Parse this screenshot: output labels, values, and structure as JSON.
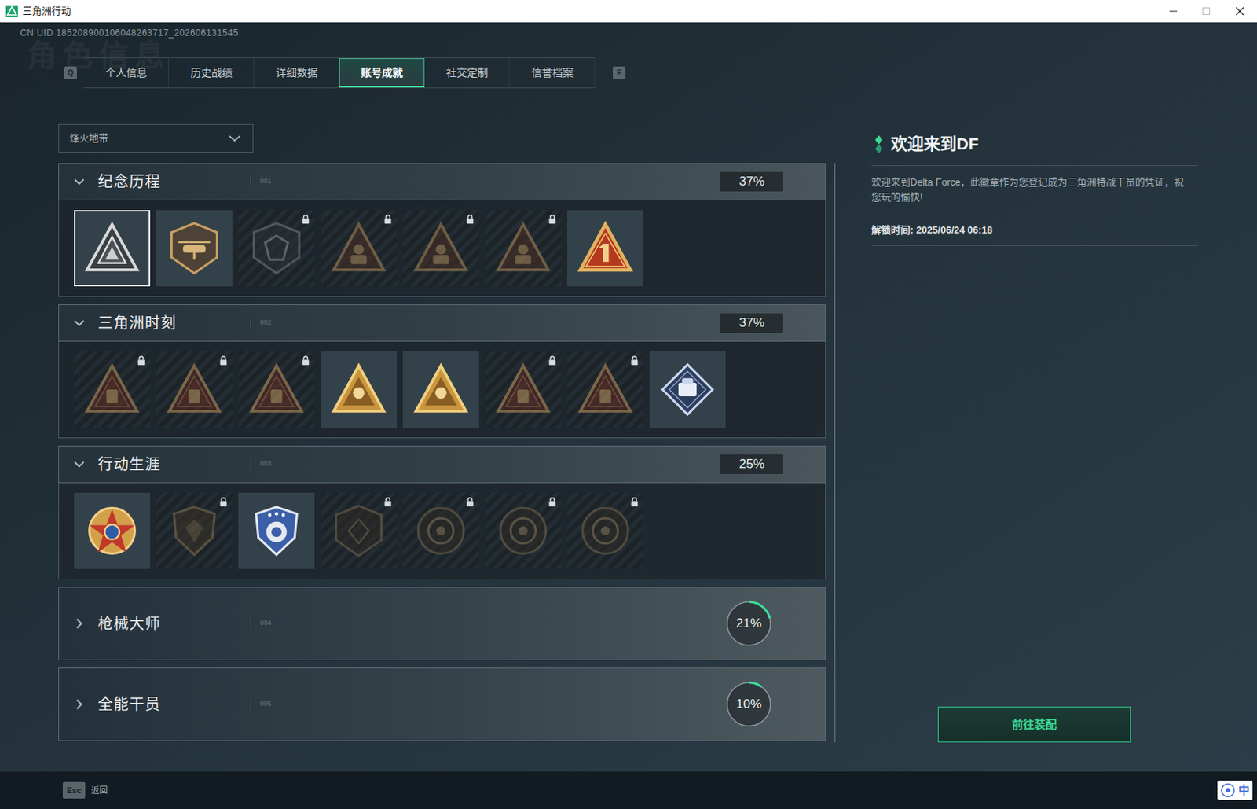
{
  "window": {
    "title": "三角洲行动"
  },
  "uid": "CN UID 185208900106048263717_202606131545",
  "watermark": "角色信息",
  "tabs": {
    "prev_key": "Q",
    "next_key": "E",
    "items": [
      {
        "label": "个人信息",
        "selected": false
      },
      {
        "label": "历史战绩",
        "selected": false
      },
      {
        "label": "详细数据",
        "selected": false
      },
      {
        "label": "账号成就",
        "selected": true
      },
      {
        "label": "社交定制",
        "selected": false
      },
      {
        "label": "信誉档案",
        "selected": false
      }
    ]
  },
  "mode_select": {
    "value": "烽火地带"
  },
  "sections": [
    {
      "title": "纪念历程",
      "index": "001",
      "percent": "37%",
      "expanded": true,
      "badges": [
        {
          "locked": false,
          "selected": true
        },
        {
          "locked": false,
          "selected": false
        },
        {
          "locked": true,
          "selected": false
        },
        {
          "locked": true,
          "selected": false
        },
        {
          "locked": true,
          "selected": false
        },
        {
          "locked": true,
          "selected": false
        },
        {
          "locked": false,
          "selected": false
        }
      ]
    },
    {
      "title": "三角洲时刻",
      "index": "002",
      "percent": "37%",
      "expanded": true,
      "badges": [
        {
          "locked": true,
          "selected": false
        },
        {
          "locked": true,
          "selected": false
        },
        {
          "locked": true,
          "selected": false
        },
        {
          "locked": false,
          "selected": false
        },
        {
          "locked": false,
          "selected": false
        },
        {
          "locked": true,
          "selected": false
        },
        {
          "locked": true,
          "selected": false
        },
        {
          "locked": false,
          "selected": false
        }
      ]
    },
    {
      "title": "行动生涯",
      "index": "003",
      "percent": "25%",
      "expanded": true,
      "badges": [
        {
          "locked": false,
          "selected": false
        },
        {
          "locked": true,
          "selected": false
        },
        {
          "locked": false,
          "selected": false
        },
        {
          "locked": true,
          "selected": false
        },
        {
          "locked": true,
          "selected": false
        },
        {
          "locked": true,
          "selected": false
        },
        {
          "locked": true,
          "selected": false
        }
      ]
    },
    {
      "title": "枪械大师",
      "index": "004",
      "percent": "21%",
      "expanded": false,
      "level": 0.21,
      "badges": []
    },
    {
      "title": "全能干员",
      "index": "005",
      "percent": "10%",
      "expanded": false,
      "level": 0.1,
      "badges": []
    }
  ],
  "detail": {
    "title": "欢迎来到DF",
    "description": "欢迎来到Delta Force，此徽章作为您登记成为三角洲特战干员的凭证，祝您玩的愉快!",
    "unlock_time": "解锁时间: 2025/06/24 06:18",
    "button": "前往装配"
  },
  "footer": {
    "key": "Esc",
    "label": "返回"
  },
  "ime": "中"
}
